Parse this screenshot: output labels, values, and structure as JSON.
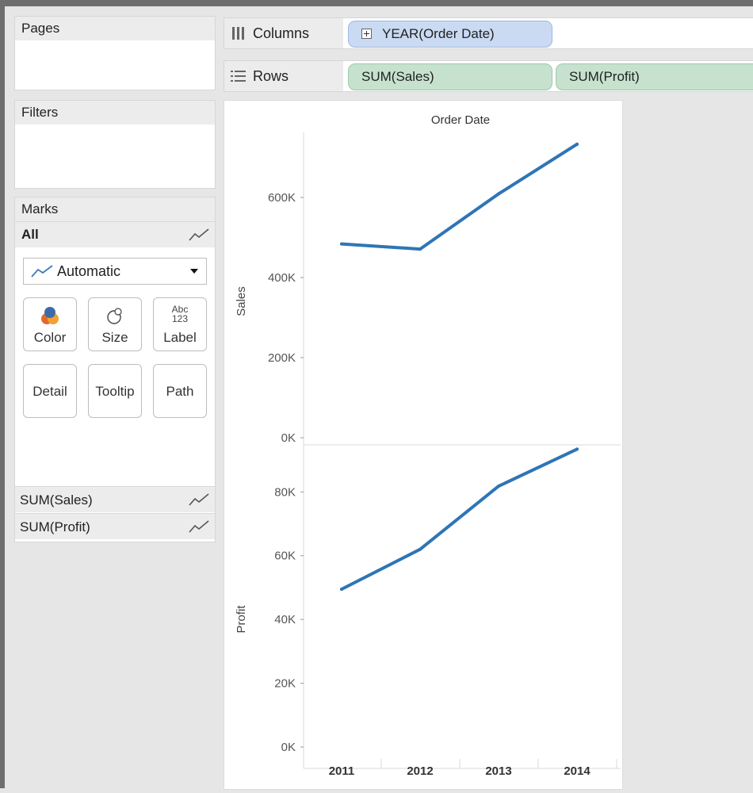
{
  "left_panel": {
    "pages_title": "Pages",
    "filters_title": "Filters",
    "marks": {
      "title": "Marks",
      "all_label": "All",
      "mark_type": "Automatic",
      "buttons": [
        {
          "label": "Color",
          "icon": "color-icon"
        },
        {
          "label": "Size",
          "icon": "size-icon"
        },
        {
          "label": "Label",
          "icon": "label-icon",
          "icon_text_top": "Abc",
          "icon_text_bottom": "123"
        },
        {
          "label": "Detail"
        },
        {
          "label": "Tooltip"
        },
        {
          "label": "Path"
        }
      ],
      "measure_rows": [
        "SUM(Sales)",
        "SUM(Profit)"
      ]
    }
  },
  "shelves": {
    "columns_label": "Columns",
    "rows_label": "Rows",
    "column_pills": [
      "YEAR(Order Date)"
    ],
    "row_pills": [
      "SUM(Sales)",
      "SUM(Profit)"
    ]
  },
  "colors": {
    "line": "#2e75b6",
    "row_pill": "#c6e2cf",
    "column_pill": "#c9daf2"
  },
  "chart_data": {
    "type": "line",
    "header": "Order Date",
    "categories": [
      "2011",
      "2012",
      "2013",
      "2014"
    ],
    "panes": [
      {
        "ylabel": "Sales",
        "ylim": [
          0,
          800000
        ],
        "ticks": [
          0,
          200000,
          400000,
          600000
        ],
        "tick_labels": [
          "0K",
          "200K",
          "400K",
          "600K"
        ],
        "values": [
          484000,
          471000,
          609000,
          733000
        ]
      },
      {
        "ylabel": "Profit",
        "ylim": [
          0,
          95000
        ],
        "ticks": [
          0,
          20000,
          40000,
          60000,
          80000
        ],
        "tick_labels": [
          "0K",
          "20K",
          "40K",
          "60K",
          "80K"
        ],
        "values": [
          49500,
          62000,
          81800,
          93400
        ]
      }
    ]
  }
}
